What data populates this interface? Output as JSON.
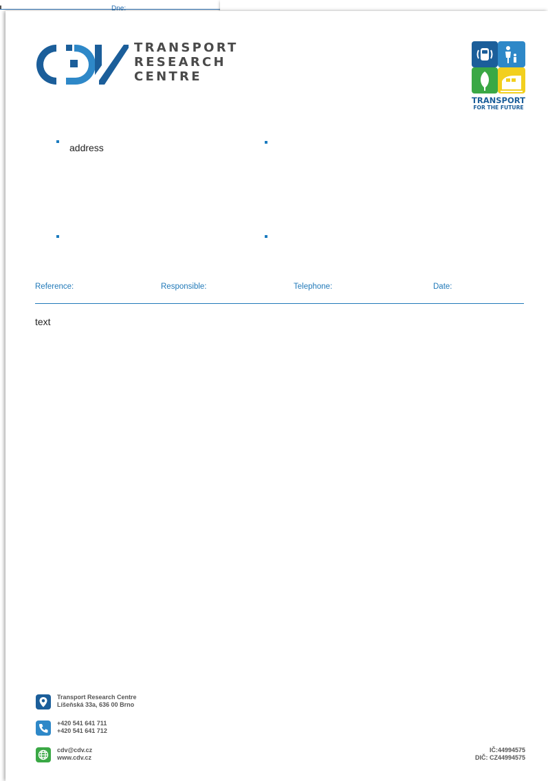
{
  "background_pages": {
    "top_label": "Dne:"
  },
  "logo": {
    "line1": "TRANSPORT",
    "line2": "RESEARCH",
    "line3": "CENTRE"
  },
  "badge": {
    "title": "TRANSPORT",
    "subtitle": "FOR THE FUTURE",
    "tile_colors": [
      "#1b5e9a",
      "#2e88c8",
      "#3aa845",
      "#f2cf1e"
    ]
  },
  "address": {
    "placeholder_text": "address"
  },
  "reference_row": {
    "reference": "Reference:",
    "responsible": "Responsible:",
    "telephone": "Telephone:",
    "date": "Date:"
  },
  "body": {
    "text": "text"
  },
  "footer": {
    "org_name": "Transport Research Centre",
    "org_address": "Líšeňská 33a, 636 00 Brno",
    "phone1": "+420 541 641 711",
    "phone2": "+420 541 641 712",
    "email": "cdv@cdv.cz",
    "web": "www.cdv.cz",
    "ic": "IČ:44994575",
    "dic": "DIČ: CZ44994575"
  },
  "colors": {
    "brand_dark_blue": "#1b5e9a",
    "brand_light_blue": "#2e88c8",
    "accent_line": "#1f78b8",
    "green": "#3aa845",
    "yellow": "#f2cf1e"
  }
}
